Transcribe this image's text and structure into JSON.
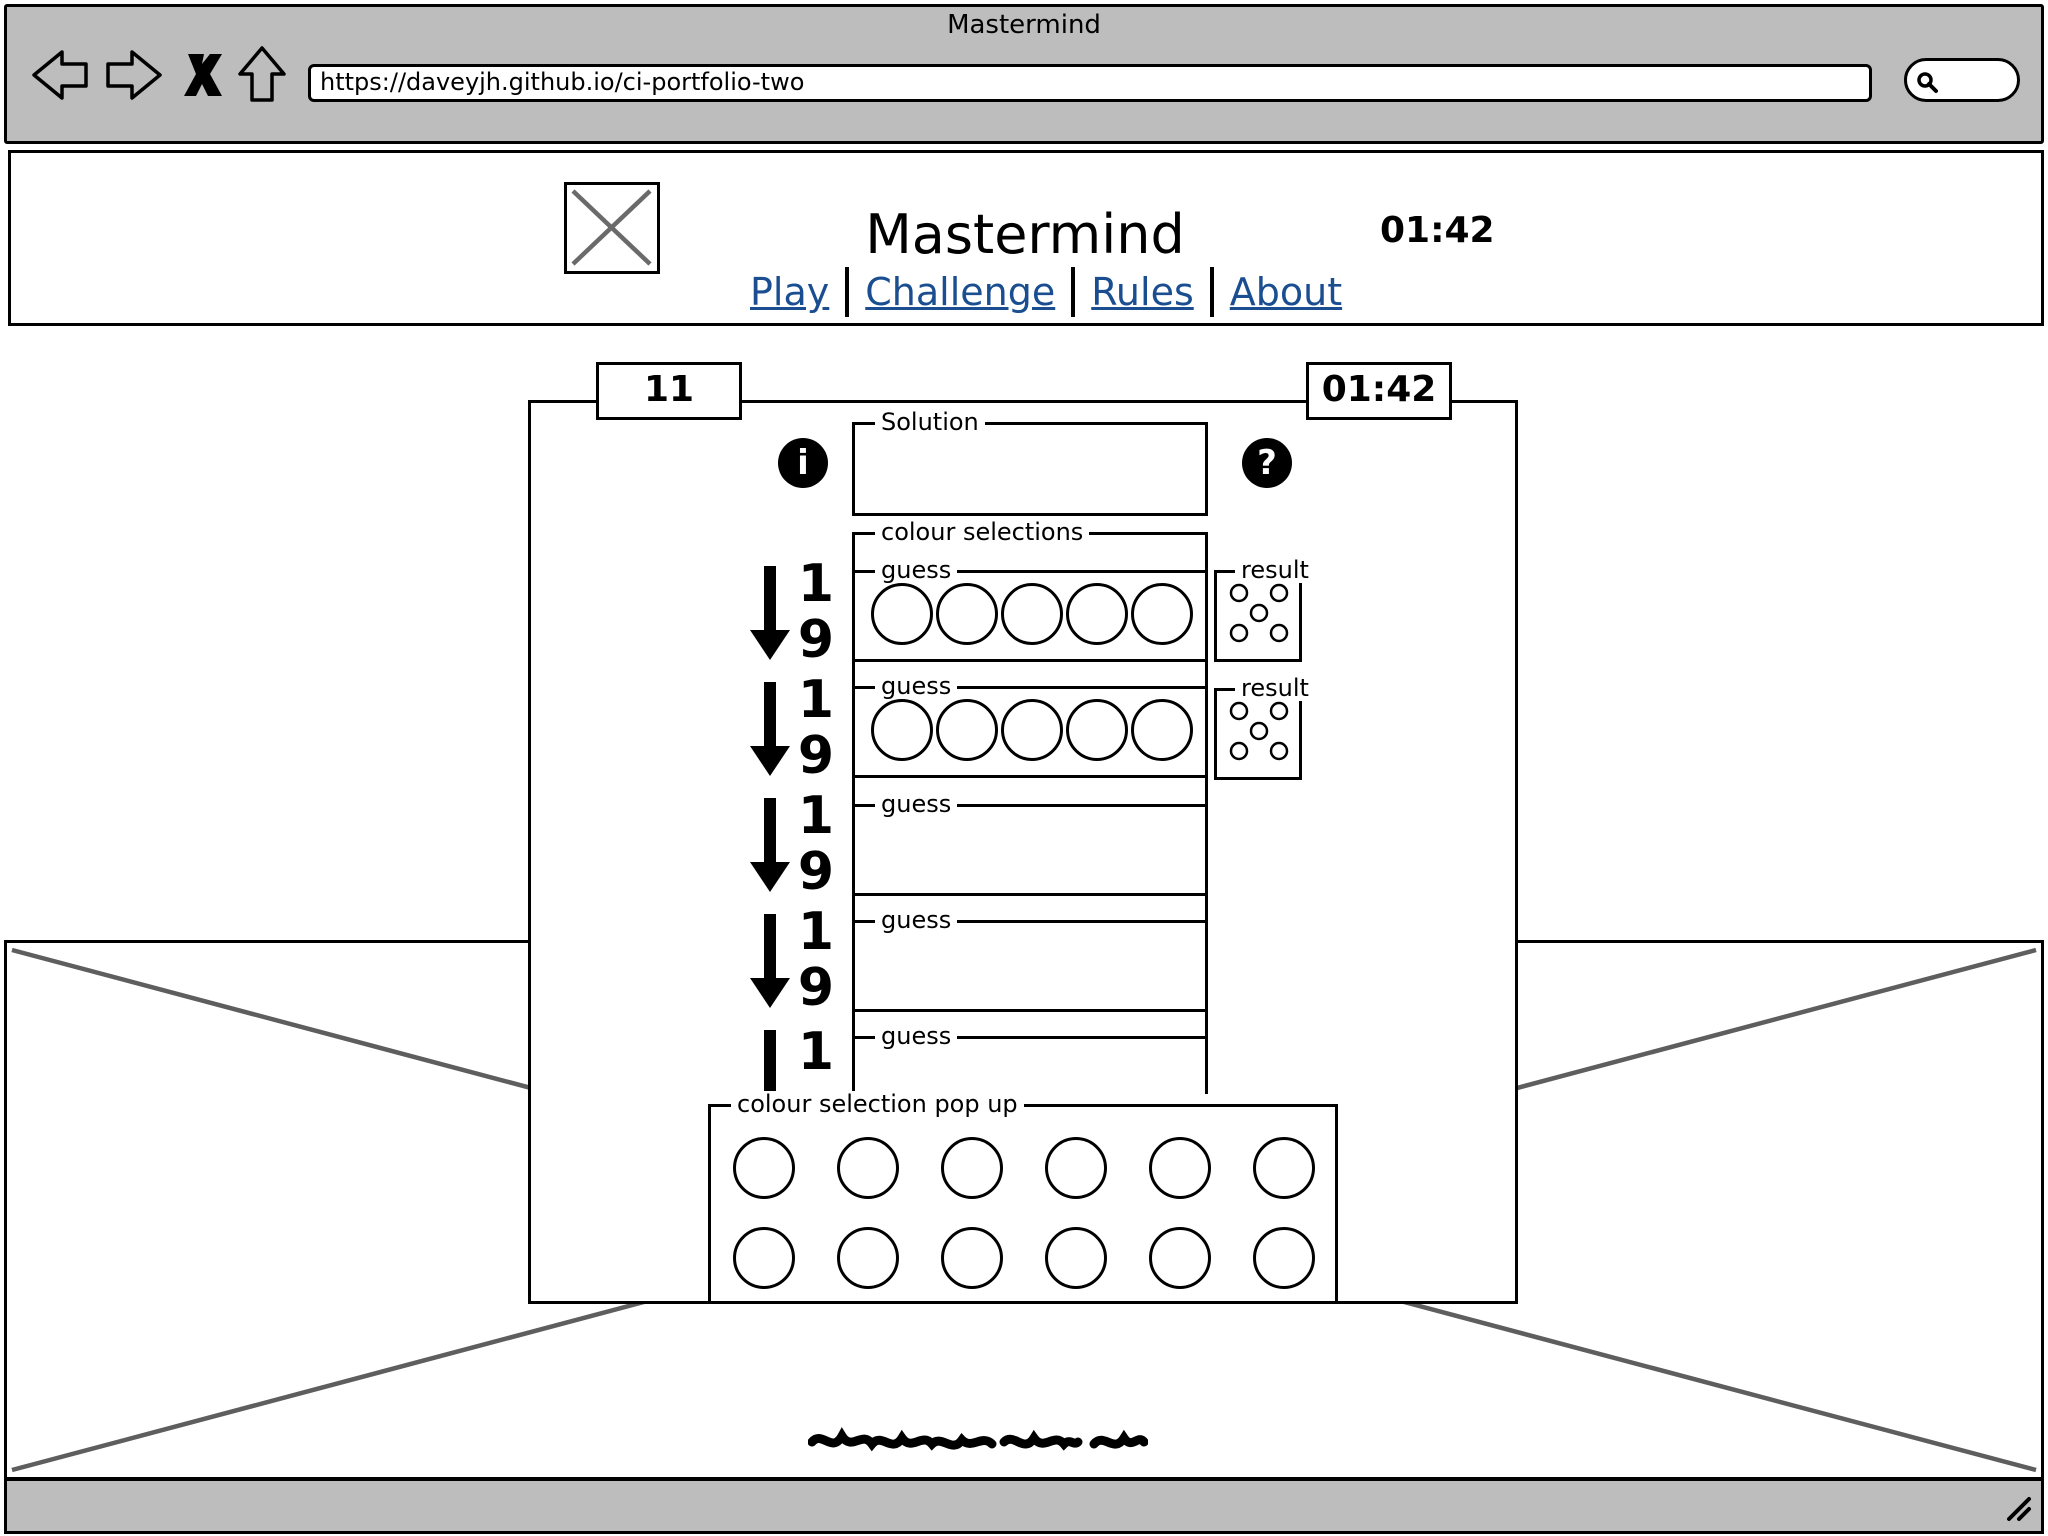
{
  "browser": {
    "window_title": "Mastermind",
    "url": "https://daveyjh.github.io/ci-portfolio-two"
  },
  "header": {
    "title": "Mastermind",
    "timer": "01:42",
    "nav": [
      "Play",
      "Challenge",
      "Rules",
      "About"
    ]
  },
  "board": {
    "count": "11",
    "timer": "01:42",
    "info_icon": "i",
    "help_icon": "?",
    "solution_label": "Solution",
    "colour_selections_label": "colour selections",
    "guess_label": "guess",
    "result_label": "result",
    "row_numbers": [
      "1",
      "9"
    ],
    "popup_label": "colour selection pop up"
  }
}
